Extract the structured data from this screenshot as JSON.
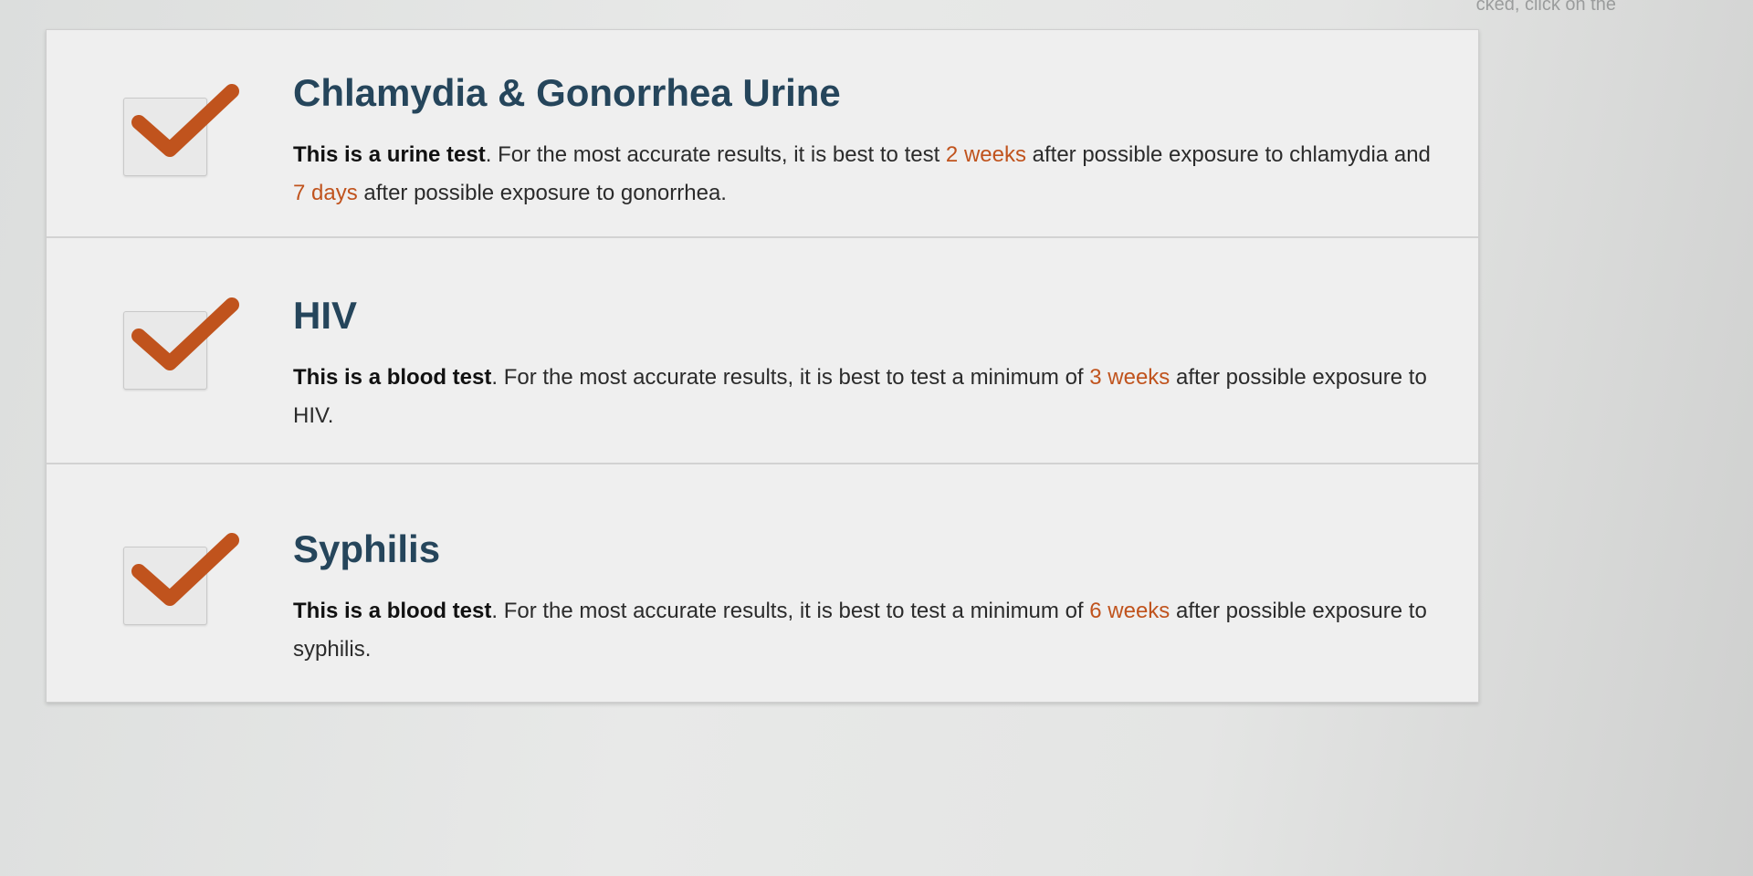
{
  "top_hint": "cked, click on the",
  "accent_color": "#c0531d",
  "items": [
    {
      "title": "Chlamydia & Gonorrhea Urine",
      "bold": "This is a urine test",
      "t1": ". For the most accurate results, it is best to test ",
      "h1": "2 weeks",
      "t2": " after possible exposure to chlamydia and ",
      "h2": "7 days",
      "t3": " after possible exposure to gonorrhea."
    },
    {
      "title": "HIV",
      "bold": "This is a blood test",
      "t1": ". For the most accurate results, it is best to test a minimum of ",
      "h1": "3 weeks",
      "t2": " after possible exposure to HIV."
    },
    {
      "title": "Syphilis",
      "bold": "This is a blood test",
      "t1": ". For the most accurate results, it is best to test a minimum of ",
      "h1": "6 weeks",
      "t2": " after possible exposure to syphilis."
    }
  ]
}
